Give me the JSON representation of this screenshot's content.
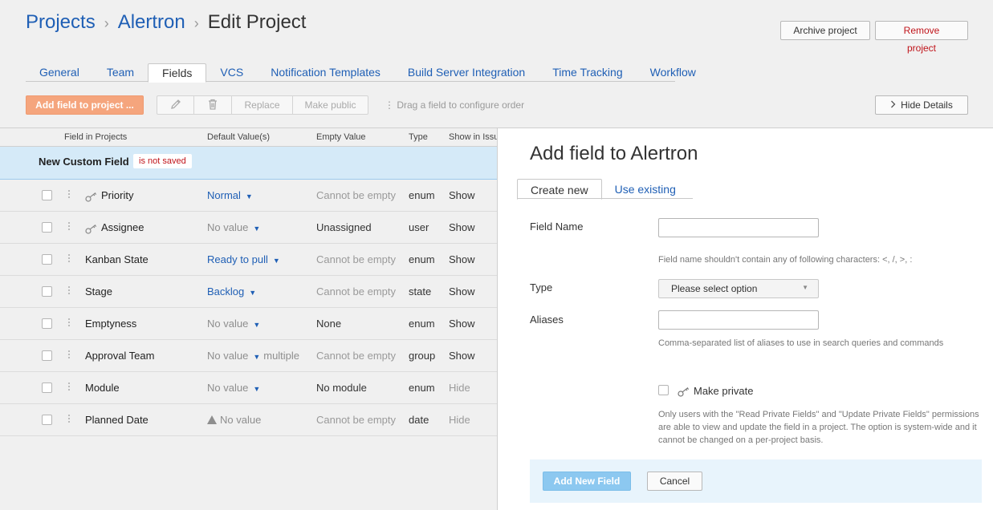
{
  "breadcrumb": {
    "projects": "Projects",
    "project": "Alertron",
    "current": "Edit Project",
    "sep": "›"
  },
  "header": {
    "archive_label": "Archive project",
    "remove_label": "Remove project"
  },
  "tabs": [
    "General",
    "Team",
    "Fields",
    "VCS",
    "Notification Templates",
    "Build Server Integration",
    "Time Tracking",
    "Workflow"
  ],
  "active_tab": "Fields",
  "toolbar": {
    "add_field_label": "Add field to project ...",
    "replace_label": "Replace",
    "make_public_label": "Make public",
    "drag_hint": "⋮ Drag a field to configure order",
    "hide_details_label": "Hide Details"
  },
  "table": {
    "columns": {
      "field": "Field in Projects",
      "default": "Default Value(s)",
      "empty": "Empty Value",
      "type": "Type",
      "show": "Show in Issue"
    },
    "new_field": {
      "name": "New Custom Field",
      "badge": "is not saved"
    },
    "rows": [
      {
        "name": "Priority",
        "private": true,
        "default": "Normal",
        "default_style": "link",
        "default_extra": "",
        "empty": "Cannot be empty",
        "empty_style": "muted",
        "type": "enum",
        "show": "Show"
      },
      {
        "name": "Assignee",
        "private": true,
        "default": "No value",
        "default_style": "muted",
        "default_extra": "",
        "empty": "Unassigned",
        "empty_style": "dark",
        "type": "user",
        "show": "Show"
      },
      {
        "name": "Kanban State",
        "private": false,
        "default": "Ready to pull",
        "default_style": "link",
        "default_extra": "",
        "empty": "Cannot be empty",
        "empty_style": "muted",
        "type": "enum",
        "show": "Show"
      },
      {
        "name": "Stage",
        "private": false,
        "default": "Backlog",
        "default_style": "link",
        "default_extra": "",
        "empty": "Cannot be empty",
        "empty_style": "muted",
        "type": "state",
        "show": "Show"
      },
      {
        "name": "Emptyness",
        "private": false,
        "default": "No value",
        "default_style": "muted",
        "default_extra": "",
        "empty": "None",
        "empty_style": "dark",
        "type": "enum",
        "show": "Show"
      },
      {
        "name": "Approval Team",
        "private": false,
        "default": "No value",
        "default_style": "muted",
        "default_extra": "multiple",
        "empty": "Cannot be empty",
        "empty_style": "muted",
        "type": "group",
        "show": "Show"
      },
      {
        "name": "Module",
        "private": false,
        "default": "No value",
        "default_style": "muted",
        "default_extra": "",
        "empty": "No module",
        "empty_style": "dark",
        "type": "enum",
        "show": "Hide"
      },
      {
        "name": "Planned Date",
        "private": false,
        "default": "No value",
        "default_style": "warn",
        "default_extra": "",
        "empty": "Cannot be empty",
        "empty_style": "muted",
        "type": "date",
        "show": "Hide"
      }
    ]
  },
  "panel": {
    "title": "Add field to Alertron",
    "tabs": [
      "Create new",
      "Use existing"
    ],
    "field_name_label": "Field Name",
    "field_name_value": "",
    "field_name_hint": "Field name shouldn't contain any of following characters: <, /, >, :",
    "type_label": "Type",
    "type_value": "Please select option",
    "aliases_label": "Aliases",
    "aliases_value": "",
    "aliases_hint": "Comma-separated list of aliases to use in search queries and commands",
    "private_label": "Make private",
    "private_checked": false,
    "private_hint": "Only users with the \"Read Private Fields\" and \"Update Private Fields\" permissions are able to view and update the field in a project. The option is system-wide and it cannot be changed on a per-project basis.",
    "add_label": "Add New Field",
    "cancel_label": "Cancel"
  },
  "colors": {
    "link": "#1f5fb5",
    "accent_orange": "#f5a57d",
    "danger": "#c0141a",
    "selection": "#d5eaf8",
    "primary_disabled": "#8cc8f0"
  },
  "icons": {
    "pencil": "pencil-icon",
    "trash": "trash-icon",
    "key": "key-icon",
    "drag": "drag-handle-icon",
    "chevron": "chevron-right-icon",
    "warning": "warning-icon"
  }
}
